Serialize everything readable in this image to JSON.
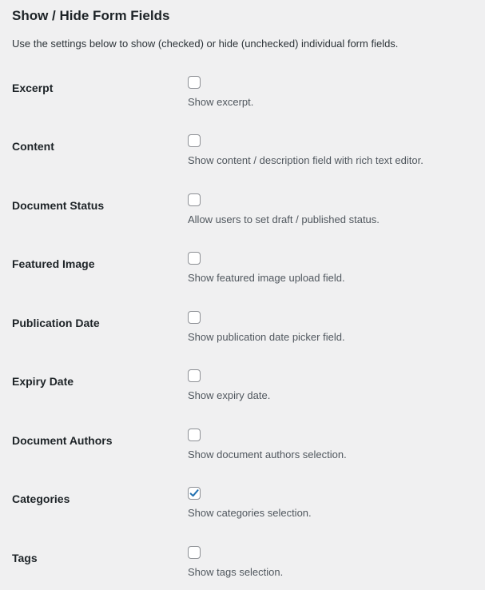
{
  "section": {
    "title": "Show / Hide Form Fields",
    "description": "Use the settings below to show (checked) or hide (unchecked) individual form fields."
  },
  "fields": [
    {
      "label": "Excerpt",
      "description": "Show excerpt.",
      "checked": false
    },
    {
      "label": "Content",
      "description": "Show content / description field with rich text editor.",
      "checked": false
    },
    {
      "label": "Document Status",
      "description": "Allow users to set draft / published status.",
      "checked": false
    },
    {
      "label": "Featured Image",
      "description": "Show featured image upload field.",
      "checked": false
    },
    {
      "label": "Publication Date",
      "description": "Show publication date picker field.",
      "checked": false
    },
    {
      "label": "Expiry Date",
      "description": "Show expiry date.",
      "checked": false
    },
    {
      "label": "Document Authors",
      "description": "Show document authors selection.",
      "checked": false
    },
    {
      "label": "Categories",
      "description": "Show categories selection.",
      "checked": true
    },
    {
      "label": "Tags",
      "description": "Show tags selection.",
      "checked": false
    }
  ],
  "colors": {
    "background": "#f0f0f1",
    "checkmark": "#2271b1",
    "checkbox_border": "#8c8f94"
  }
}
